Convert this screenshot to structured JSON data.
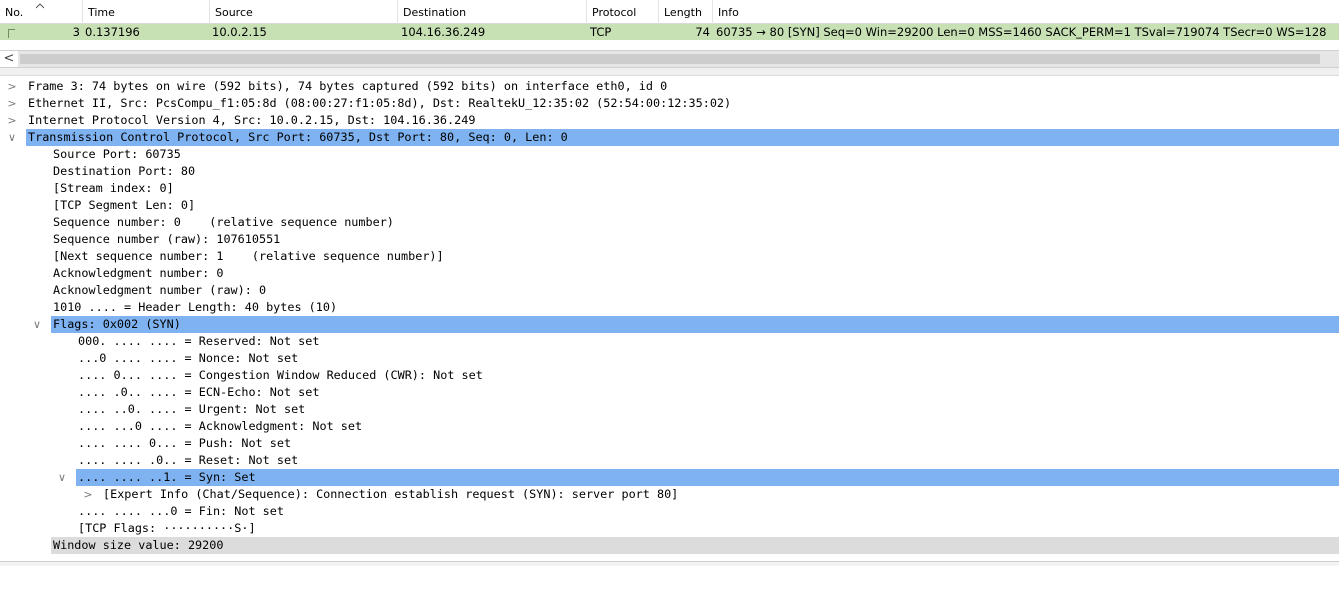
{
  "packet_list": {
    "columns": [
      "No.",
      "Time",
      "Source",
      "Destination",
      "Protocol",
      "Length",
      "Info"
    ],
    "row": {
      "no": "3",
      "time": "0.137196",
      "source": "10.0.2.15",
      "destination": "104.16.36.249",
      "protocol": "TCP",
      "length": "74",
      "info": "60735 → 80 [SYN] Seq=0 Win=29200 Len=0 MSS=1460 SACK_PERM=1 TSval=719074 TSecr=0 WS=128"
    },
    "row_color": "#c7e1b5"
  },
  "scrollbar": {
    "left_arrow": "<"
  },
  "details": {
    "selection_color": "#7fb2f0",
    "lines": [
      {
        "text": "Frame 3: 74 bytes on wire (592 bits), 74 bytes captured (592 bits) on interface eth0, id 0",
        "arrow": ">"
      },
      {
        "text": "Ethernet II, Src: PcsCompu_f1:05:8d (08:00:27:f1:05:8d), Dst: RealtekU_12:35:02 (52:54:00:12:35:02)",
        "arrow": ">"
      },
      {
        "text": "Internet Protocol Version 4, Src: 10.0.2.15, Dst: 104.16.36.249",
        "arrow": ">"
      },
      {
        "text": "Transmission Control Protocol, Src Port: 60735, Dst Port: 80, Seq: 0, Len: 0",
        "arrow": "∨"
      },
      {
        "text": "Source Port: 60735"
      },
      {
        "text": "Destination Port: 80"
      },
      {
        "text": "[Stream index: 0]"
      },
      {
        "text": "[TCP Segment Len: 0]"
      },
      {
        "text": "Sequence number: 0    (relative sequence number)"
      },
      {
        "text": "Sequence number (raw): 107610551"
      },
      {
        "text": "[Next sequence number: 1    (relative sequence number)]"
      },
      {
        "text": "Acknowledgment number: 0"
      },
      {
        "text": "Acknowledgment number (raw): 0"
      },
      {
        "text": "1010 .... = Header Length: 40 bytes (10)"
      },
      {
        "text": "Flags: 0x002 (SYN)",
        "arrow": "∨"
      },
      {
        "text": "000. .... .... = Reserved: Not set"
      },
      {
        "text": "...0 .... .... = Nonce: Not set"
      },
      {
        "text": ".... 0... .... = Congestion Window Reduced (CWR): Not set"
      },
      {
        "text": ".... .0.. .... = ECN-Echo: Not set"
      },
      {
        "text": ".... ..0. .... = Urgent: Not set"
      },
      {
        "text": ".... ...0 .... = Acknowledgment: Not set"
      },
      {
        "text": ".... .... 0... = Push: Not set"
      },
      {
        "text": ".... .... .0.. = Reset: Not set"
      },
      {
        "text": ".... .... ..1. = Syn: Set",
        "arrow": "∨"
      },
      {
        "text": "[Expert Info (Chat/Sequence): Connection establish request (SYN): server port 80]",
        "arrow": ">"
      },
      {
        "text": ".... .... ...0 = Fin: Not set"
      },
      {
        "text": "[TCP Flags: ··········S·]"
      },
      {
        "text": "Window size value: 29200"
      }
    ]
  }
}
